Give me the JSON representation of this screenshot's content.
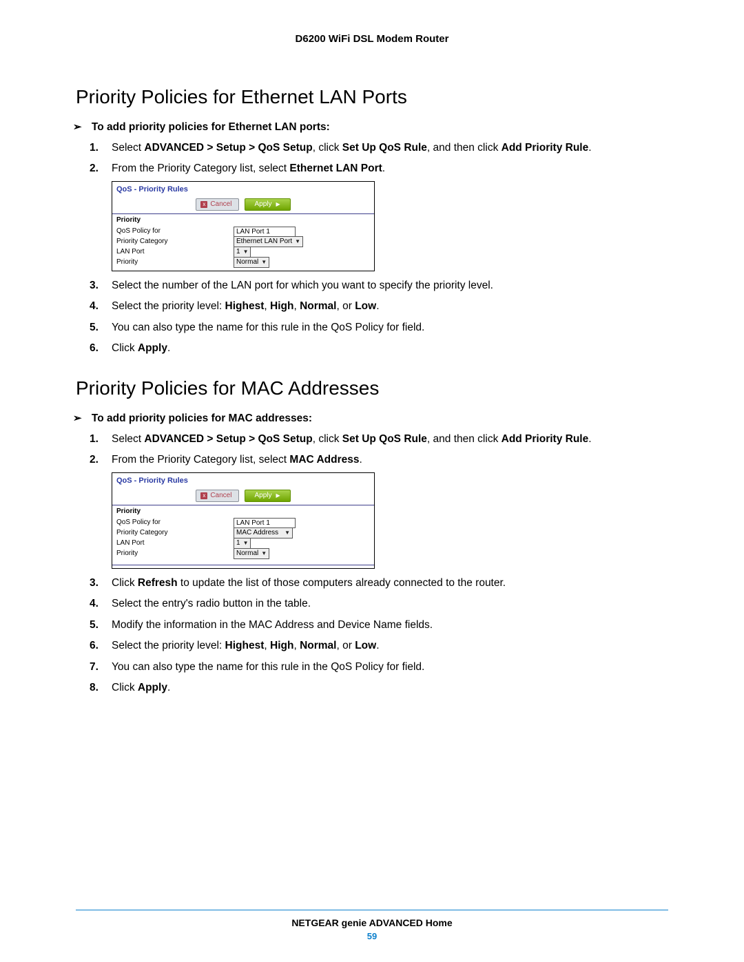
{
  "header": {
    "title": "D6200 WiFi DSL Modem Router"
  },
  "section1": {
    "heading": "Priority Policies for Ethernet LAN Ports",
    "intro": "To add priority policies for Ethernet LAN ports:",
    "step1_a": "Select ",
    "step1_b": "ADVANCED > Setup > QoS Setup",
    "step1_c": ", click ",
    "step1_d": "Set Up QoS Rule",
    "step1_e": ", and then click ",
    "step1_f": "Add Priority Rule",
    "step1_g": ".",
    "step2_a": "From the Priority Category list, select ",
    "step2_b": "Ethernet LAN Port",
    "step2_c": ".",
    "step3": "Select the number of the LAN port for which you want to specify the priority level.",
    "step4_a": "Select the priority level: ",
    "step4_b": "Highest",
    "step4_c": "High",
    "step4_d": "Normal",
    "step4_e": "Low",
    "step5": "You can also type the name for this rule in the QoS Policy for field.",
    "step6_a": "Click ",
    "step6_b": "Apply",
    "step6_c": "."
  },
  "section2": {
    "heading": "Priority Policies for MAC Addresses",
    "intro": "To add priority policies for MAC addresses:",
    "step1_a": "Select ",
    "step1_b": "ADVANCED > Setup > QoS Setup",
    "step1_c": ", click ",
    "step1_d": "Set Up QoS Rule",
    "step1_e": ", and then click ",
    "step1_f": "Add Priority Rule",
    "step1_g": ".",
    "step2_a": "From the Priority Category list, select ",
    "step2_b": "MAC Address",
    "step2_c": ".",
    "step3_a": "Click ",
    "step3_b": "Refresh",
    "step3_c": " to update the list of those computers already connected to the router.",
    "step4": "Select the entry's radio button in the table.",
    "step5": "Modify the information in the MAC Address and Device Name fields.",
    "step6_a": "Select the priority level: ",
    "step6_b": "Highest",
    "step6_c": "High",
    "step6_d": "Normal",
    "step6_e": "Low",
    "step7": "You can also type the name for this rule in the QoS Policy for field.",
    "step8_a": "Click ",
    "step8_b": "Apply",
    "step8_c": "."
  },
  "figure1": {
    "title": "QoS - Priority Rules",
    "cancel": "Cancel",
    "apply": "Apply",
    "subhead": "Priority",
    "row1": "QoS Policy for",
    "row1_val": "LAN Port 1",
    "row2": "Priority Category",
    "row2_val": "Ethernet LAN Port",
    "row3": "LAN Port",
    "row3_val": "1",
    "row4": "Priority",
    "row4_val": "Normal"
  },
  "figure2": {
    "title": "QoS - Priority Rules",
    "cancel": "Cancel",
    "apply": "Apply",
    "subhead": "Priority",
    "row1": "QoS Policy for",
    "row1_val": "LAN Port 1",
    "row2": "Priority Category",
    "row2_val": "MAC Address",
    "row3": "LAN Port",
    "row3_val": "1",
    "row4": "Priority",
    "row4_val": "Normal"
  },
  "footer": {
    "line": "NETGEAR genie ADVANCED Home",
    "page": "59"
  },
  "nums": {
    "n1": "1.",
    "n2": "2.",
    "n3": "3.",
    "n4": "4.",
    "n5": "5.",
    "n6": "6.",
    "n7": "7.",
    "n8": "8."
  },
  "sep": {
    "comma": ", ",
    "or": ", or ",
    "period": "."
  },
  "arrow": "➢"
}
